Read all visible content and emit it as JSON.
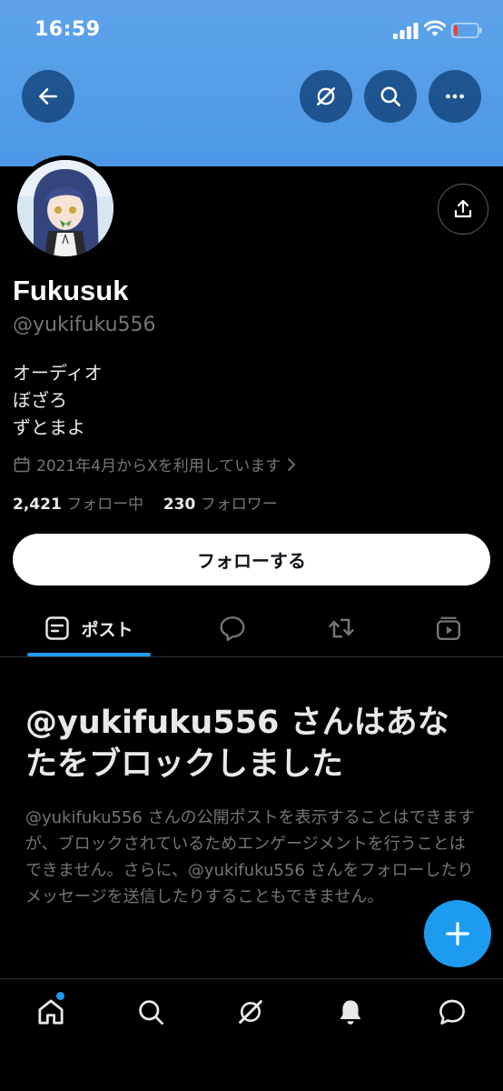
{
  "status_bar": {
    "time": "16:59"
  },
  "header": {
    "back_icon": "arrow-left-icon",
    "grok_icon": "grok-icon",
    "search_icon": "search-icon",
    "more_icon": "more-dots-icon"
  },
  "profile": {
    "name": "Fukusuk",
    "handle": "@yukifuku556",
    "bio_lines": [
      "オーディオ",
      "ぼざろ",
      "ずとまよ"
    ],
    "joined": "2021年4月からXを利用しています",
    "following_count": "2,421",
    "following_label": "フォロー中",
    "followers_count": "230",
    "followers_label": "フォロワー",
    "follow_button": "フォローする"
  },
  "tabs": {
    "posts_label": "ポスト",
    "replies_icon": "reply-icon",
    "reposts_icon": "repost-icon",
    "media_icon": "media-icon"
  },
  "blocked": {
    "title": "@yukifuku556 さんはあなたをブロックしました",
    "body": "@yukifuku556 さんの公開ポストを表示することはできますが、ブロックされているためエンゲージメントを行うことはできません。さらに、@yukifuku556 さんをフォローしたりメッセージを送信したりすることもできません。"
  },
  "bottom_nav": [
    "home-icon",
    "search-icon",
    "grok-icon",
    "bell-icon",
    "messages-icon"
  ],
  "colors": {
    "accent": "#1d9bf0",
    "banner": "#4c98e6",
    "background": "#000000",
    "muted": "#71767b"
  }
}
